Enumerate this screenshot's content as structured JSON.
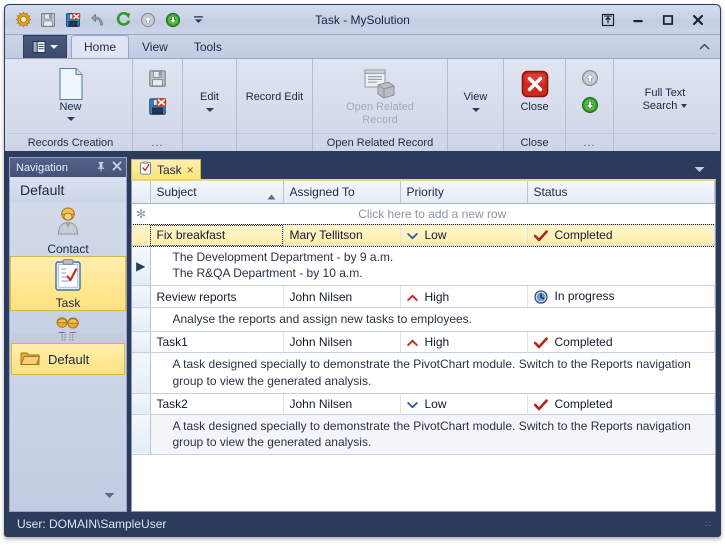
{
  "window": {
    "title": "Task - MySolution",
    "quick_access": [
      {
        "name": "app-settings-icon",
        "label": "Settings"
      },
      {
        "name": "save-icon",
        "label": "Save"
      },
      {
        "name": "save-close-icon",
        "label": "Save and Close"
      },
      {
        "name": "undo-icon",
        "label": "Undo"
      },
      {
        "name": "refresh-icon",
        "label": "Refresh"
      },
      {
        "name": "move-up-icon",
        "label": "Move Up"
      },
      {
        "name": "move-down-icon",
        "label": "Move Down"
      },
      {
        "name": "qat-overflow-icon",
        "label": "Customize Quick Access Toolbar"
      }
    ],
    "controls": [
      {
        "name": "restore-ribbon-button",
        "glyph": "restore"
      },
      {
        "name": "minimize-button",
        "glyph": "minimize"
      },
      {
        "name": "maximize-button",
        "glyph": "maximize"
      },
      {
        "name": "close-button",
        "glyph": "close"
      }
    ]
  },
  "ribbon": {
    "app_menu_label": "",
    "tabs": [
      {
        "label": "Home",
        "active": true
      },
      {
        "label": "View",
        "active": false
      },
      {
        "label": "Tools",
        "active": false
      }
    ],
    "collapse_label": "",
    "groups": [
      {
        "name": "records-creation",
        "label": "Records Creation",
        "buttons": [
          {
            "label": "New",
            "dropdown": true,
            "disabled": false
          }
        ]
      },
      {
        "name": "edit",
        "label": "...",
        "buttons": [
          {
            "label": "Edit",
            "dropdown": true,
            "disabled": false
          }
        ],
        "small_buttons": [
          {
            "label": "Save",
            "icon": "save-icon"
          },
          {
            "label": "Save and Close",
            "icon": "save-close-icon"
          }
        ]
      },
      {
        "name": "record-edit",
        "label": "",
        "buttons": [
          {
            "label": "Record Edit",
            "dropdown": true,
            "disabled": false
          }
        ]
      },
      {
        "name": "open-related-record",
        "label": "Open Related Record",
        "buttons": [
          {
            "label_line1": "Open Related",
            "label_line2": "Record",
            "disabled": true
          }
        ]
      },
      {
        "name": "view",
        "label": "",
        "buttons": [
          {
            "label": "View",
            "dropdown": true,
            "disabled": false
          }
        ]
      },
      {
        "name": "close",
        "label": "Close",
        "buttons": [
          {
            "label": "Close",
            "disabled": false
          }
        ]
      },
      {
        "name": "navigate",
        "label": "...",
        "small_buttons": [
          {
            "label": "Previous",
            "icon": "move-up-icon"
          },
          {
            "label": "Next",
            "icon": "move-down-icon"
          }
        ]
      },
      {
        "name": "full-text-search",
        "label": "",
        "buttons": [
          {
            "label_line1": "Full Text",
            "label_line2": "Search",
            "dropdown": true
          }
        ]
      }
    ]
  },
  "navigation": {
    "header_title": "Navigation",
    "header_icons": [
      {
        "name": "pin-icon",
        "glyph": "pin"
      },
      {
        "name": "close-icon",
        "glyph": "close"
      }
    ],
    "group_title": "Default",
    "items": [
      {
        "label": "Contact",
        "icon": "contact-icon",
        "selected": false,
        "has_caret": false
      },
      {
        "label": "Task",
        "icon": "task-icon",
        "selected": true,
        "has_caret": false
      },
      {
        "label": "Department",
        "icon": "department-icon",
        "selected": false,
        "has_caret": true
      }
    ],
    "groups": [
      {
        "label": "Default",
        "icon": "folder-icon",
        "selected": true
      }
    ],
    "overflow_label": ""
  },
  "document": {
    "tab": {
      "label": "Task",
      "icon": "task-icon",
      "close_glyph": "×"
    },
    "tab_menu_label": ""
  },
  "grid": {
    "columns": [
      {
        "label": "Subject",
        "sorted": "asc"
      },
      {
        "label": "Assigned To",
        "sorted": null
      },
      {
        "label": "Priority",
        "sorted": null
      },
      {
        "label": "Status",
        "sorted": null
      }
    ],
    "new_row_text": "Click here to add a new row",
    "new_row_indicator": "✻",
    "rows": [
      {
        "indicator": "",
        "focused": true,
        "subject": "Fix breakfast",
        "assigned_to": "Mary Tellitson",
        "priority": "Low",
        "priority_icon": "priority-low-icon",
        "status": "Completed",
        "status_icon": "status-completed-icon",
        "detail_indicator": "▶",
        "detail_lines": [
          "The Development Department - by 9 a.m.",
          "The R&QA Department - by 10 a.m."
        ]
      },
      {
        "indicator": "",
        "focused": false,
        "subject": "Review reports",
        "assigned_to": "John Nilsen",
        "priority": "High",
        "priority_icon": "priority-high-icon",
        "status": "In progress",
        "status_icon": "status-inprogress-icon",
        "detail_indicator": "",
        "detail_lines": [
          "Analyse the reports and assign new tasks to employees."
        ]
      },
      {
        "indicator": "",
        "focused": false,
        "subject": "Task1",
        "assigned_to": "John Nilsen",
        "priority": "High",
        "priority_icon": "priority-high-icon",
        "status": "Completed",
        "status_icon": "status-completed-icon",
        "detail_indicator": "",
        "detail_lines": [
          "A task designed specially to demonstrate the PivotChart module. Switch to the Reports navigation group to view the generated analysis."
        ]
      },
      {
        "indicator": "",
        "focused": false,
        "subject": "Task2",
        "assigned_to": "John Nilsen",
        "priority": "Low",
        "priority_icon": "priority-low-icon",
        "status": "Completed",
        "status_icon": "status-completed-icon",
        "detail_indicator": "",
        "detail_lines": [
          "A task designed specially to demonstrate the PivotChart module. Switch to the Reports navigation group to view the generated analysis."
        ]
      }
    ]
  },
  "statusbar": {
    "user_text": "User: DOMAIN\\SampleUser",
    "grip": "∷"
  },
  "colors": {
    "window_frame": "#2b3b5c",
    "ribbon": "#d6dcec",
    "selection_yellow": "#ffe27c",
    "selection_border": "#d9b441",
    "accent_red": "#c0281e",
    "accent_green": "#3c9b28",
    "text_dark": "#1b2740"
  }
}
